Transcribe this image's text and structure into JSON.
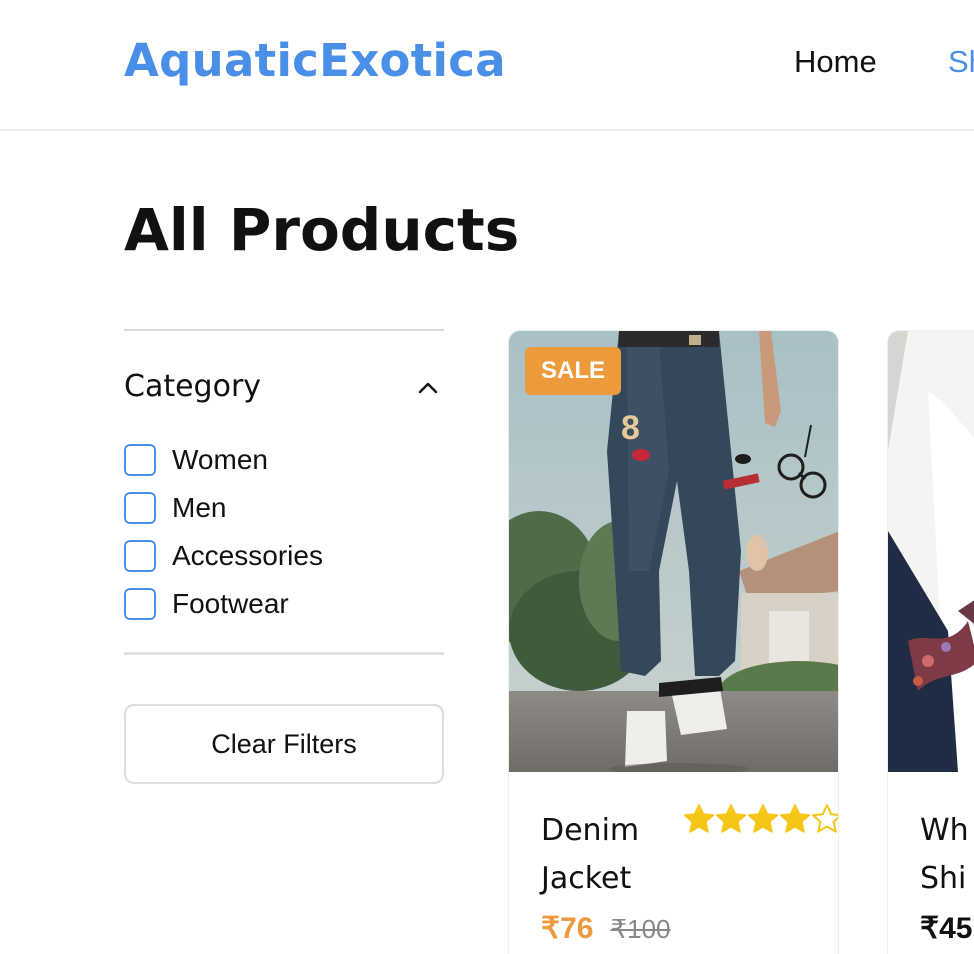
{
  "header": {
    "brand": "AquaticExotica",
    "nav": [
      {
        "label": "Home"
      },
      {
        "label": "Sh"
      }
    ]
  },
  "page": {
    "title": "All Products"
  },
  "filters": {
    "category_title": "Category",
    "options": [
      {
        "label": "Women",
        "checked": false
      },
      {
        "label": "Men",
        "checked": false
      },
      {
        "label": "Accessories",
        "checked": false
      },
      {
        "label": "Footwear",
        "checked": false
      }
    ],
    "clear_label": "Clear Filters"
  },
  "products": [
    {
      "badge": "SALE",
      "name": "Denim Jacket",
      "rating": 4,
      "rating_max": 5,
      "price": "₹76",
      "original_price": "₹100"
    },
    {
      "name": "Wh Shi",
      "price": "₹45"
    }
  ],
  "colors": {
    "accent": "#4a8fe7",
    "sale": "#ec9a3c",
    "star": "#f5c518"
  }
}
